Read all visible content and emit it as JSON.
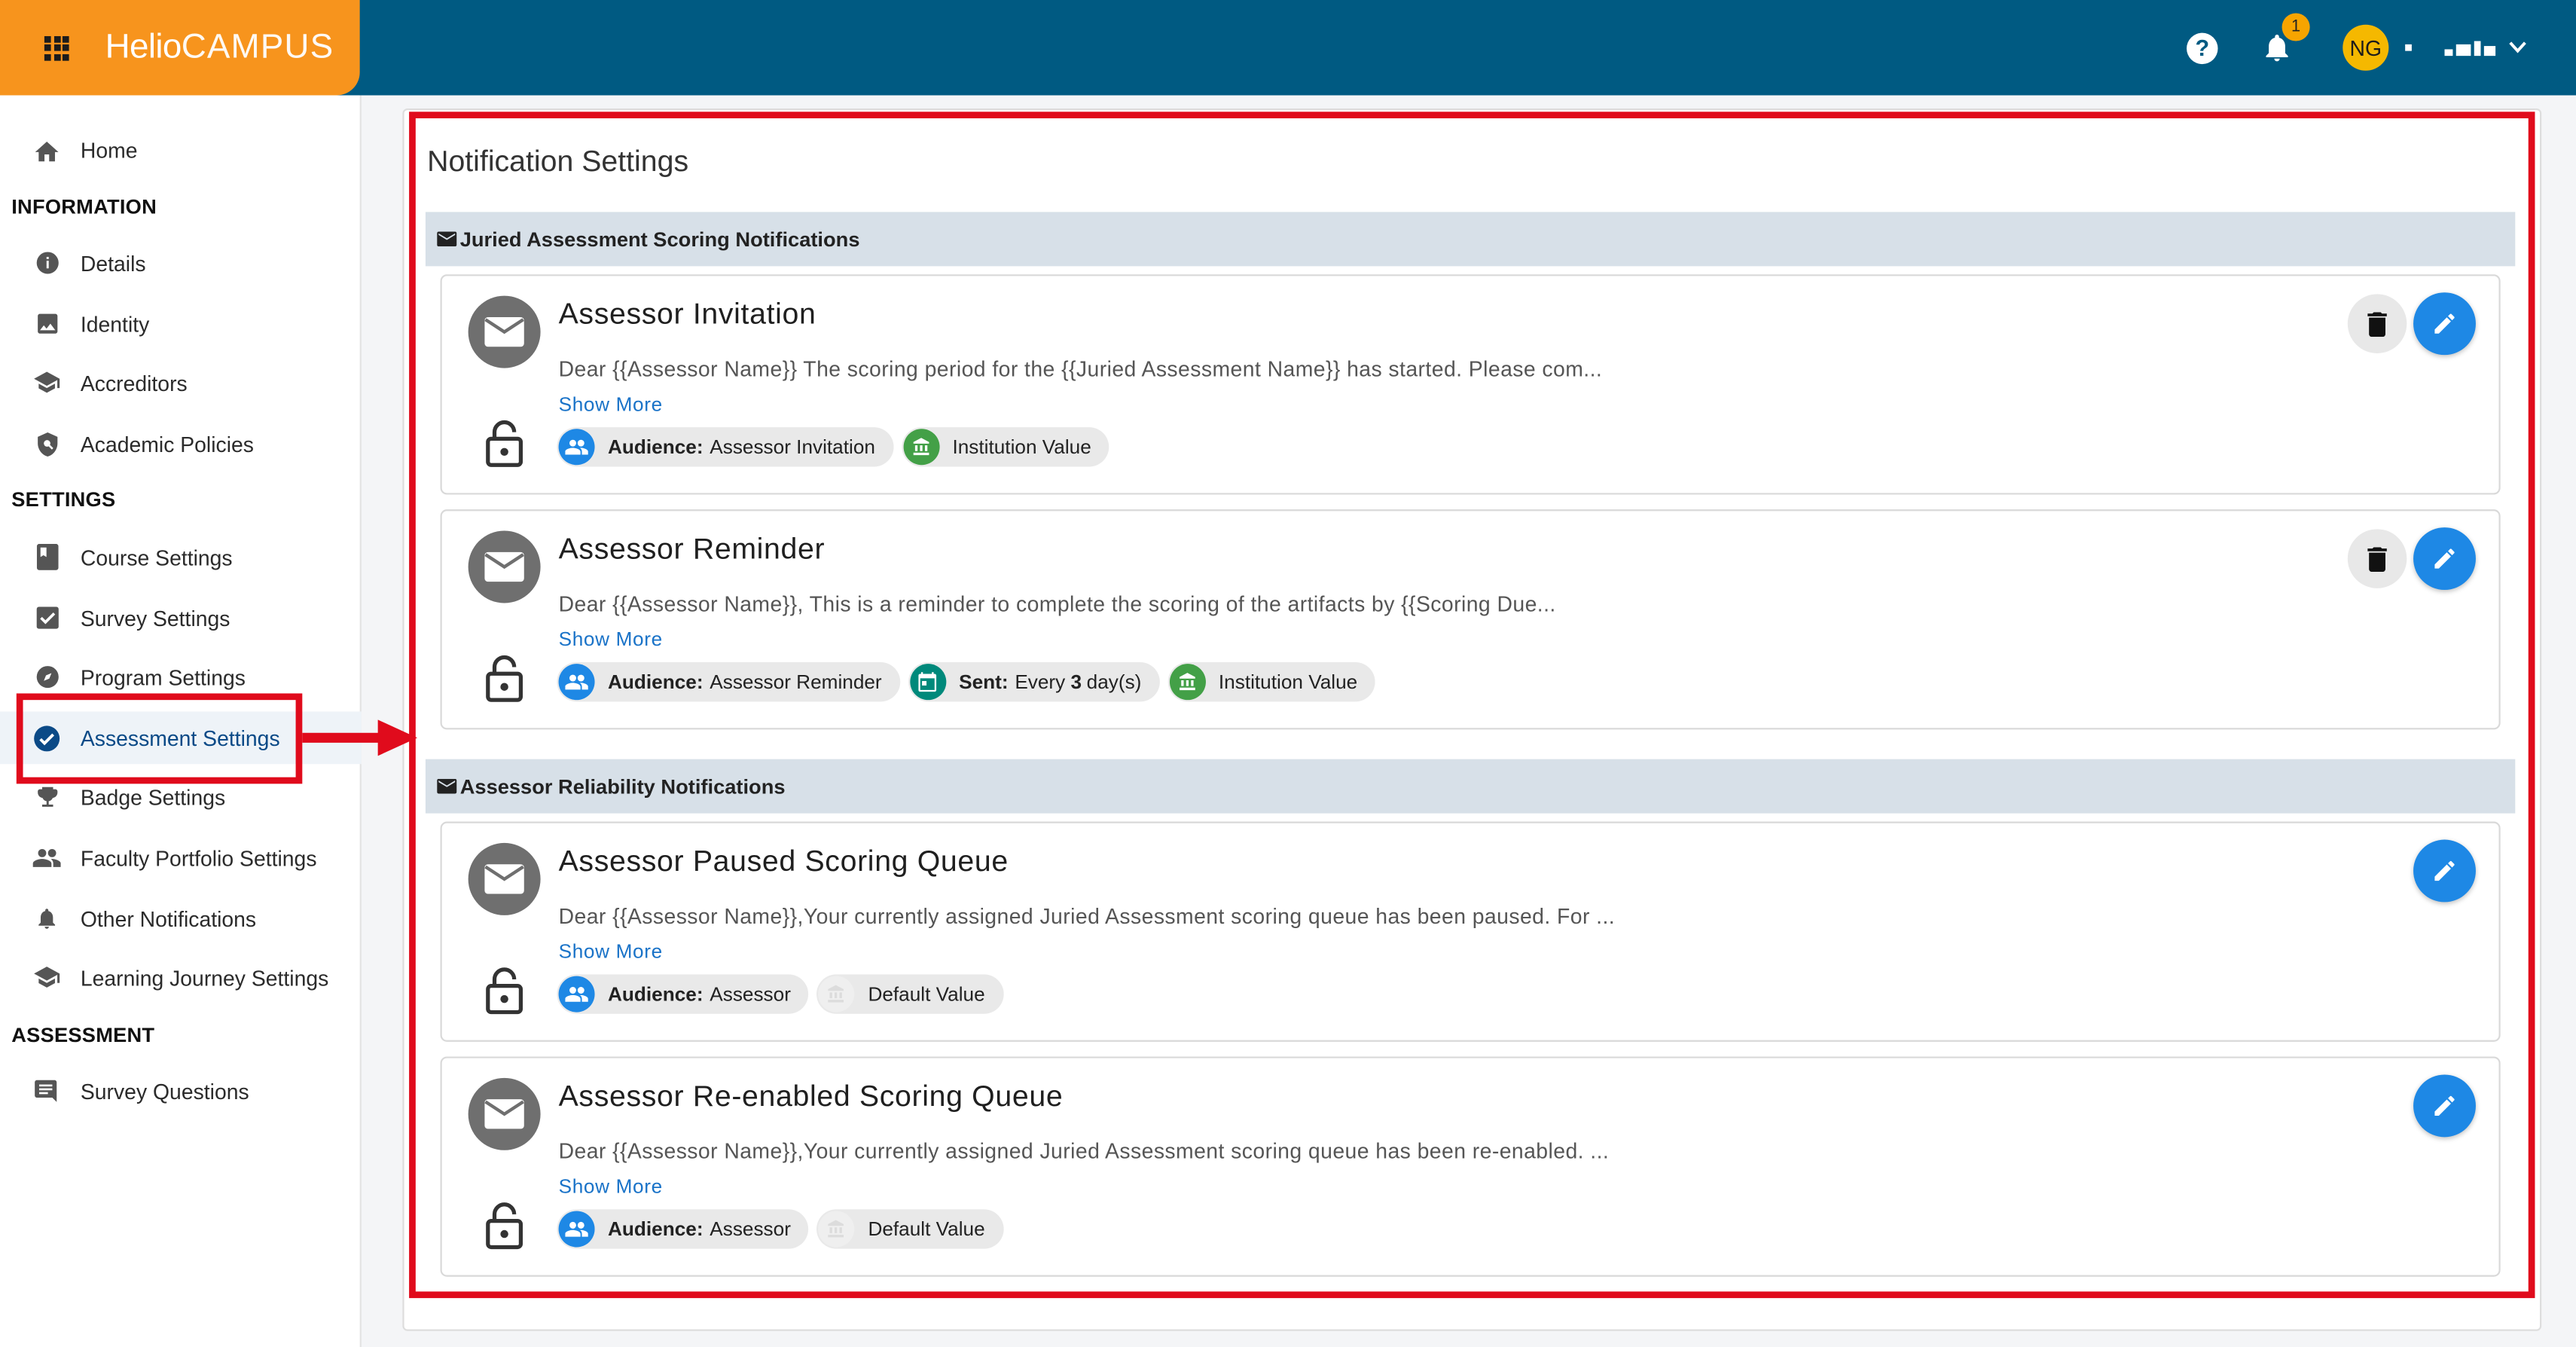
{
  "app": {
    "brand_bold": "Helio",
    "brand_light": "CAMPUS",
    "notification_count": "1",
    "user_initials": "NG",
    "help_icon": "?"
  },
  "sidebar": {
    "home": "Home",
    "section_information": "INFORMATION",
    "details": "Details",
    "identity": "Identity",
    "accreditors": "Accreditors",
    "academic_policies": "Academic Policies",
    "section_settings": "SETTINGS",
    "course_settings": "Course Settings",
    "survey_settings": "Survey Settings",
    "program_settings": "Program Settings",
    "assessment_settings": "Assessment Settings",
    "badge_settings": "Badge Settings",
    "faculty_portfolio_settings": "Faculty Portfolio Settings",
    "other_notifications": "Other Notifications",
    "learning_journey_settings": "Learning Journey Settings",
    "section_assessment": "ASSESSMENT",
    "survey_questions": "Survey Questions"
  },
  "main": {
    "title": "Notification Settings",
    "sections": [
      {
        "heading": "Juried Assessment Scoring Notifications",
        "cards": [
          {
            "title": "Assessor Invitation",
            "description": "Dear {{Assessor Name}} The scoring period for the {{Juried Assessment Name}} has started. Please com...",
            "show_more": "Show More",
            "audience_label": "Audience:",
            "audience_value": "Assessor Invitation",
            "value_chip": "Institution Value"
          },
          {
            "title": "Assessor Reminder",
            "description": "Dear {{Assessor Name}}, This is a reminder to complete the scoring of the artifacts by {{Scoring Due...",
            "show_more": "Show More",
            "audience_label": "Audience:",
            "audience_value": "Assessor Reminder",
            "sent_label": "Sent:",
            "sent_prefix": "Every",
            "sent_count": "3",
            "sent_suffix": "day(s)",
            "value_chip": "Institution Value"
          }
        ]
      },
      {
        "heading": "Assessor Reliability Notifications",
        "cards": [
          {
            "title": "Assessor Paused Scoring Queue",
            "description": "Dear {{Assessor Name}},Your currently assigned Juried Assessment scoring queue has been paused. For ...",
            "show_more": "Show More",
            "audience_label": "Audience:",
            "audience_value": "Assessor",
            "value_chip": "Default Value"
          },
          {
            "title": "Assessor Re-enabled Scoring Queue",
            "description": "Dear {{Assessor Name}},Your currently assigned Juried Assessment scoring queue has been re-enabled. ...",
            "show_more": "Show More",
            "audience_label": "Audience:",
            "audience_value": "Assessor",
            "value_chip": "Default Value"
          }
        ]
      }
    ]
  },
  "colors": {
    "header": "#005a82",
    "brand": "#f7941d",
    "accent_blue": "#1e88e5",
    "highlight_red": "#e00b1c",
    "institution_green": "#43a047",
    "schedule_teal": "#00897b"
  }
}
